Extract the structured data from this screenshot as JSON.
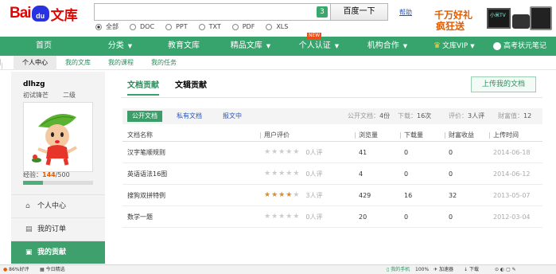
{
  "header": {
    "logo": {
      "bai": "Bai",
      "du": "du",
      "wenku": "文库"
    },
    "search_badge": "3",
    "search_button": "百度一下",
    "help": "帮助",
    "scopes": [
      {
        "label": "全部",
        "selected": true
      },
      {
        "label": "DOC",
        "selected": false
      },
      {
        "label": "PPT",
        "selected": false
      },
      {
        "label": "TXT",
        "selected": false
      },
      {
        "label": "PDF",
        "selected": false
      },
      {
        "label": "XLS",
        "selected": false
      }
    ],
    "ad": {
      "line1": "千万好礼",
      "line2": "疯狂送",
      "tv": "小米TV"
    }
  },
  "nav": {
    "items": [
      "首页",
      "分类",
      "教育文库",
      "精品文库",
      "个人认证",
      "机构合作"
    ],
    "new_badge": "NEW",
    "vip": "文库VIP",
    "gaokao": "高考状元笔记",
    "accent": "#37a36d"
  },
  "subnav": [
    "个人中心",
    "我的文库",
    "我的课程",
    "我的任务"
  ],
  "profile": {
    "username": "dlhzg",
    "title": "初试锋芒",
    "grade": "二级",
    "exp_label": "经验：",
    "exp_value": "144",
    "exp_max": "/500",
    "exp_fraction": 0.288
  },
  "menu": [
    {
      "label": "个人中心",
      "icon": "home-icon",
      "active": false
    },
    {
      "label": "我的订单",
      "icon": "order-icon",
      "active": false
    },
    {
      "label": "我的贡献",
      "icon": "contribution-icon",
      "active": true
    }
  ],
  "tabs": [
    "文档贡献",
    "文辑贡献"
  ],
  "upload_button": "上传我的文档",
  "filters": [
    "公开文档",
    "私有文档",
    "报文中"
  ],
  "stats": {
    "public_docs_label": "公开文档：",
    "public_docs": "4份",
    "downloads_label": "下载：",
    "downloads": "16次",
    "ratings_label": "评价：",
    "ratings": "3人评",
    "wealth_label": "财富值：",
    "wealth": "12"
  },
  "table": {
    "headers": [
      "文档名称",
      "用户评价",
      "浏览量",
      "下载量",
      "财富收益",
      "上传时间"
    ],
    "rows": [
      {
        "name": "汉字笔顺规则",
        "rating": 0,
        "reviews": "0人评",
        "views": "41",
        "downloads": "0",
        "wealth": "0",
        "date": "2014-06-18"
      },
      {
        "name": "英语语法16图",
        "rating": 0,
        "reviews": "0人评",
        "views": "4",
        "downloads": "0",
        "wealth": "0",
        "date": "2014-06-12"
      },
      {
        "name": "搜狗双拼特例",
        "rating": 3.5,
        "reviews": "3人评",
        "views": "429",
        "downloads": "16",
        "wealth": "32",
        "date": "2013-05-07"
      },
      {
        "name": "数学一题",
        "rating": 0,
        "reviews": "0人评",
        "views": "20",
        "downloads": "0",
        "wealth": "0",
        "date": "2012-03-04"
      }
    ]
  },
  "statusbar": {
    "left1": "86%好评",
    "left2": "今日精选",
    "phone": "我的手机",
    "zoom": "100%",
    "accel": "加速器",
    "download": "下载"
  }
}
